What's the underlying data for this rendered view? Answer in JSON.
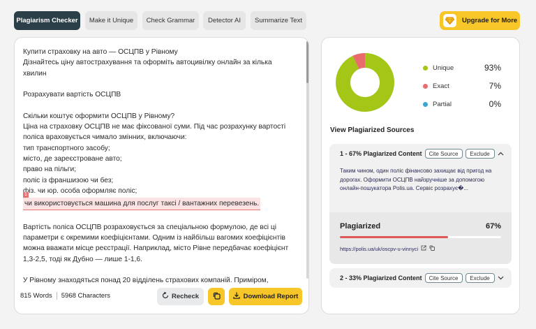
{
  "tabs": [
    {
      "label": "Plagiarism Checker"
    },
    {
      "label": "Make it Unique"
    },
    {
      "label": "Check Grammar"
    },
    {
      "label": "Detector AI"
    },
    {
      "label": "Summarize Text"
    }
  ],
  "upgrade": {
    "label": "Upgrade for More"
  },
  "editor": {
    "lines": [
      "Купити страховку на авто — ОСЦПВ у Рівному",
      "Дізнайтесь ціну автострахування та оформіть автоцивілку онлайн за кілька",
      "хвилин",
      "Розрахувати вартість ОСЦПВ",
      "Скільки коштує оформити ОСЦПВ у Рівному?",
      "Ціна на страховку ОСЦПВ не має фіксованої суми. Під час розрахунку вартості",
      "поліса враховується чимало змінних, включаючи:",
      "тип транспортного засобу;",
      "місто, де зареєстроване авто;",
      "право на пільги;",
      "поліс із франшизою чи без;",
      "фіз. чи юр. особа оформляє поліс;",
      "Вартість поліса ОСЦПВ розраховується за спеціальною формулою, де всі ці",
      "параметри є окремими коефіцієнтами. Одним із найбільш вагомих коефіцієнтів",
      "можна вважати місце реєстрації. Наприклад, місто Рівне передбачає коефіцієнт",
      "1,3-2,5, тоді як Дубно — лише 1-1,6.",
      "У Рівному знаходяться понад 20 відділень страхових компаній. Приміром,"
    ],
    "highlight": {
      "badge": "1",
      "text": "чи використовується машина для послуг таксі / вантажних перевезень."
    }
  },
  "stats": {
    "words": "815 Words",
    "characters": "5968 Characters"
  },
  "buttons": {
    "recheck": "Recheck",
    "download": "Download Report"
  },
  "results": {
    "legend": [
      {
        "label": "Unique",
        "value": "93%",
        "color": "#a3c617"
      },
      {
        "label": "Exact",
        "value": "7%",
        "color": "#ea6b6b"
      },
      {
        "label": "Partial",
        "value": "0%",
        "color": "#3aa6d0"
      }
    ],
    "donut": {
      "unique": 93,
      "exact": 7,
      "partial": 0
    },
    "sources_title": "View Plagiarized Sources",
    "sources": [
      {
        "title": "1 - 67% Plagiarized Content",
        "cite": "Cite Source",
        "exclude": "Exclude",
        "excerpt": "Таким чином, один поліс фінансово захищає від пригод на дорогах. Оформити ОСЦПВ найзручніше за допомогою онлайн-пошукатора Polis.ua. Сервіс розрахує�...",
        "plagiarized_label": "Plagiarized",
        "plagiarized_pct": "67%",
        "plagiarized_value": 67,
        "url": "https://polis.ua/uk/oscpv-u-vinnyci"
      },
      {
        "title": "2 - 33% Plagiarized Content",
        "cite": "Cite Source",
        "exclude": "Exclude"
      }
    ]
  }
}
